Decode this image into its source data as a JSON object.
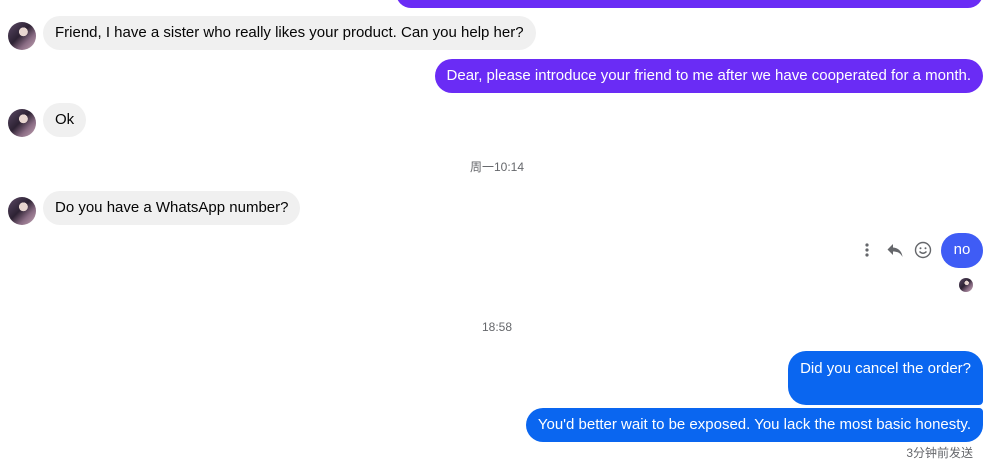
{
  "colors": {
    "incoming_bubble": "#f0f0f0",
    "outgoing_purple": "#6a2cf5",
    "outgoing_blue_violet": "#3f5cf5",
    "outgoing_blue": "#0a66f0"
  },
  "messages": {
    "m0": {
      "direction": "outgoing",
      "text": ""
    },
    "m1": {
      "direction": "incoming",
      "text": "Friend, I have a sister who really likes your product. Can you help her?"
    },
    "m2": {
      "direction": "outgoing",
      "text": "Dear, please introduce your friend to me after we have cooperated for a month."
    },
    "m3": {
      "direction": "incoming",
      "text": "Ok"
    },
    "m4": {
      "direction": "incoming",
      "text": "Do you have a WhatsApp number?"
    },
    "m5": {
      "direction": "outgoing",
      "text": "no"
    },
    "m6": {
      "direction": "outgoing",
      "text": "Did you cancel the order?"
    },
    "m7": {
      "direction": "outgoing",
      "text": "You'd better wait to be exposed. You lack the most basic honesty."
    }
  },
  "timestamps": {
    "t1": "周一10:14",
    "t2": "18:58"
  },
  "message_actions": {
    "more_icon": "vertical-dots-icon",
    "reply_icon": "reply-arrow-icon",
    "react_icon": "smiley-icon"
  },
  "status": {
    "sent": "3分钟前发送"
  }
}
